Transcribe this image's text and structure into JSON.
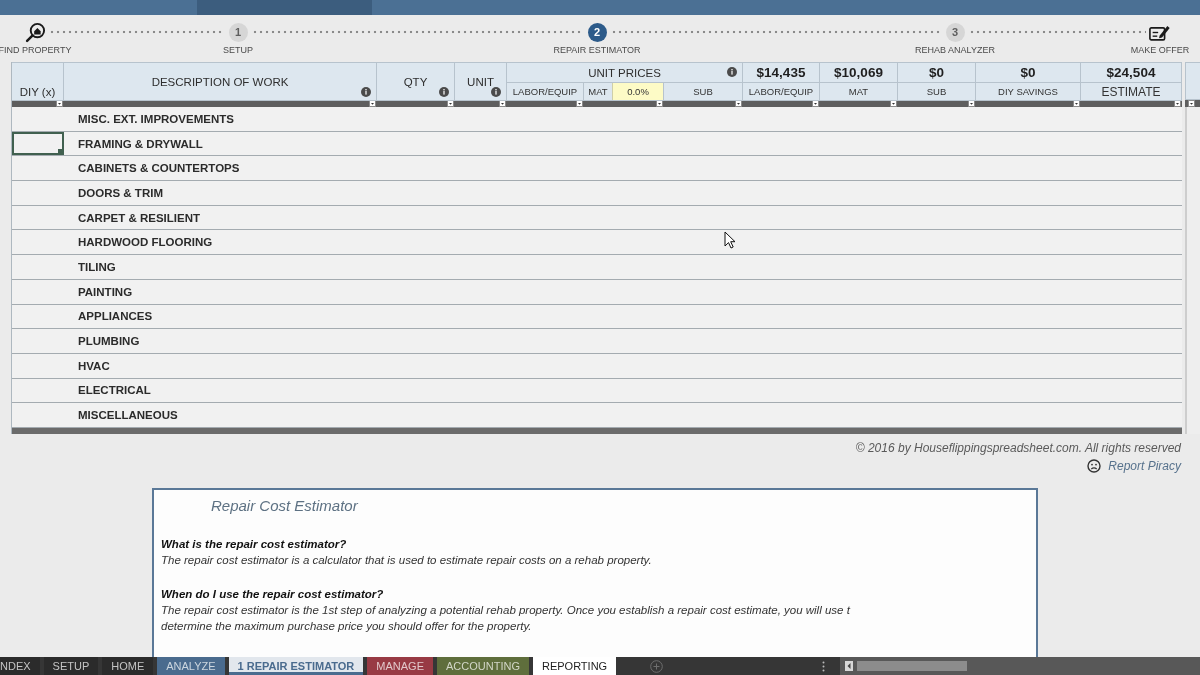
{
  "steps": [
    {
      "kind": "search",
      "label": "FIND PROPERTY",
      "selected": false
    },
    {
      "kind": "number",
      "number": "1",
      "label": "SETUP",
      "selected": false
    },
    {
      "kind": "number",
      "number": "2",
      "label": "REPAIR ESTIMATOR",
      "selected": true
    },
    {
      "kind": "number",
      "number": "3",
      "label": "REHAB ANALYZER",
      "selected": false
    },
    {
      "kind": "offer",
      "label": "MAKE OFFER",
      "selected": false
    }
  ],
  "table": {
    "columns": [
      {
        "label": "DIY (x)",
        "info": false
      },
      {
        "label": "DESCRIPTION OF WORK",
        "info": true
      },
      {
        "label": "QTY",
        "info": true
      },
      {
        "label": "UNIT",
        "info": true
      }
    ],
    "unit_prices": {
      "label": "UNIT PRICES",
      "info": true,
      "columns": [
        {
          "label": "LABOR/EQUIP"
        },
        {
          "label": "MAT",
          "markup": "0.0%"
        },
        {
          "label": "SUB"
        }
      ]
    },
    "totals": [
      {
        "value": "$14,435",
        "label": "LABOR/EQUIP"
      },
      {
        "value": "$10,069",
        "label": "MAT"
      },
      {
        "value": "$0",
        "label": "SUB"
      },
      {
        "value": "$0",
        "label": "DIY SAVINGS"
      },
      {
        "value": "$24,504",
        "label": "ESTIMATE"
      }
    ],
    "rows": [
      {
        "description": "MISC. EXT. IMPROVEMENTS",
        "selected": false
      },
      {
        "description": "FRAMING & DRYWALL",
        "selected": true
      },
      {
        "description": "CABINETS & COUNTERTOPS",
        "selected": false
      },
      {
        "description": "DOORS & TRIM",
        "selected": false
      },
      {
        "description": "CARPET & RESILIENT",
        "selected": false
      },
      {
        "description": "HARDWOOD FLOORING",
        "selected": false
      },
      {
        "description": "TILING",
        "selected": false
      },
      {
        "description": "PAINTING",
        "selected": false
      },
      {
        "description": "APPLIANCES",
        "selected": false
      },
      {
        "description": "PLUMBING",
        "selected": false
      },
      {
        "description": "HVAC",
        "selected": false
      },
      {
        "description": "ELECTRICAL",
        "selected": false
      },
      {
        "description": "MISCELLANEOUS",
        "selected": false
      }
    ]
  },
  "copyright": "© 2016 by Houseflippingspreadsheet.com. All rights reserved",
  "report_link": "Report Piracy",
  "help_box": {
    "title": "Repair Cost Estimator",
    "sections": [
      {
        "question": "What is the repair cost estimator?",
        "lines": [
          "The repair cost estimator is a calculator that is used to estimate repair costs on a rehab property."
        ]
      },
      {
        "question": "When do I use the repair cost estimator?",
        "lines": [
          "The repair cost estimator is the 1st step of analyzing a potential rehab property. Once you establish a repair cost estimate, you will use t",
          "determine the maximum purchase price you should offer for the property."
        ]
      }
    ]
  },
  "sheet_tabs": [
    {
      "label": "NDEX",
      "color": "#2b2b2b",
      "selected": false
    },
    {
      "label": "SETUP",
      "color": "#2b2b2b",
      "selected": false
    },
    {
      "label": "HOME",
      "color": "#2b2b2b",
      "selected": false
    },
    {
      "label": "ANALYZE",
      "color": "#4a6b8e",
      "selected": false
    },
    {
      "label": "1 REPAIR ESTIMATOR",
      "color": "#4a6b8e",
      "selected": true
    },
    {
      "label": "MANAGE",
      "color": "#983a44",
      "selected": false
    },
    {
      "label": "ACCOUNTING",
      "color": "#5f6e3c",
      "selected": false
    },
    {
      "label": "REPORTING",
      "color": "#ffffff",
      "selected": false
    }
  ]
}
